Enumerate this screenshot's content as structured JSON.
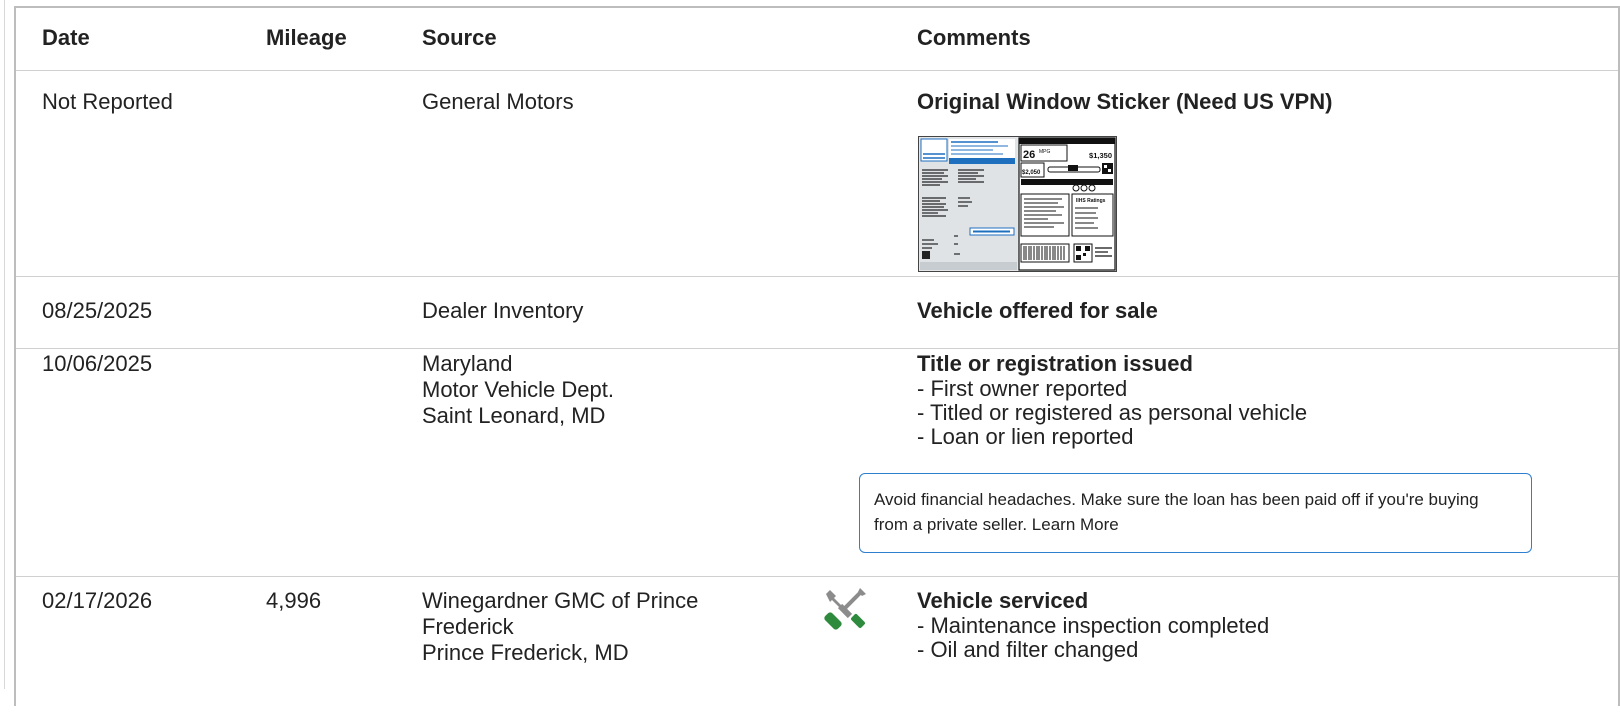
{
  "table": {
    "headers": {
      "date": "Date",
      "mileage": "Mileage",
      "source": "Source",
      "comments": "Comments"
    },
    "rows": [
      {
        "date": "Not Reported",
        "mileage": "",
        "source": [
          "General Motors"
        ],
        "title": "Original Window Sticker (Need US VPN)",
        "sticker": {
          "mpg": "26",
          "mpg_unit": "MPG",
          "fuel_cost": "$1,350",
          "savings": "$2,050",
          "ratings": "IIHS Ratings"
        }
      },
      {
        "date": "08/25/2025",
        "mileage": "",
        "source": [
          "Dealer Inventory"
        ],
        "title": "Vehicle offered for sale"
      },
      {
        "date": "10/06/2025",
        "mileage": "",
        "source": [
          "Maryland",
          "Motor Vehicle Dept.",
          "Saint Leonard, MD"
        ],
        "title": "Title or registration issued",
        "details": [
          "- First owner reported",
          "- Titled or registered as personal vehicle",
          "- Loan or lien reported"
        ],
        "tip": {
          "text": "Avoid financial headaches. Make sure the loan has been paid off if you're buying from a private seller.",
          "link": "Learn More"
        }
      },
      {
        "date": "02/17/2026",
        "mileage": "4,996",
        "source": [
          "Winegardner GMC of Prince",
          "Frederick",
          "Prince Frederick, MD"
        ],
        "icon": "service-wrench-screwdriver-icon",
        "title": "Vehicle serviced",
        "details": [
          "- Maintenance inspection completed",
          "- Oil and filter changed"
        ]
      }
    ]
  },
  "colors": {
    "border": "#bdbdbd",
    "rule": "#d0d0d0",
    "tip_border": "#2f7fd0",
    "icon_green": "#2e8b3e",
    "sticker_blue": "#1f6fbf"
  }
}
